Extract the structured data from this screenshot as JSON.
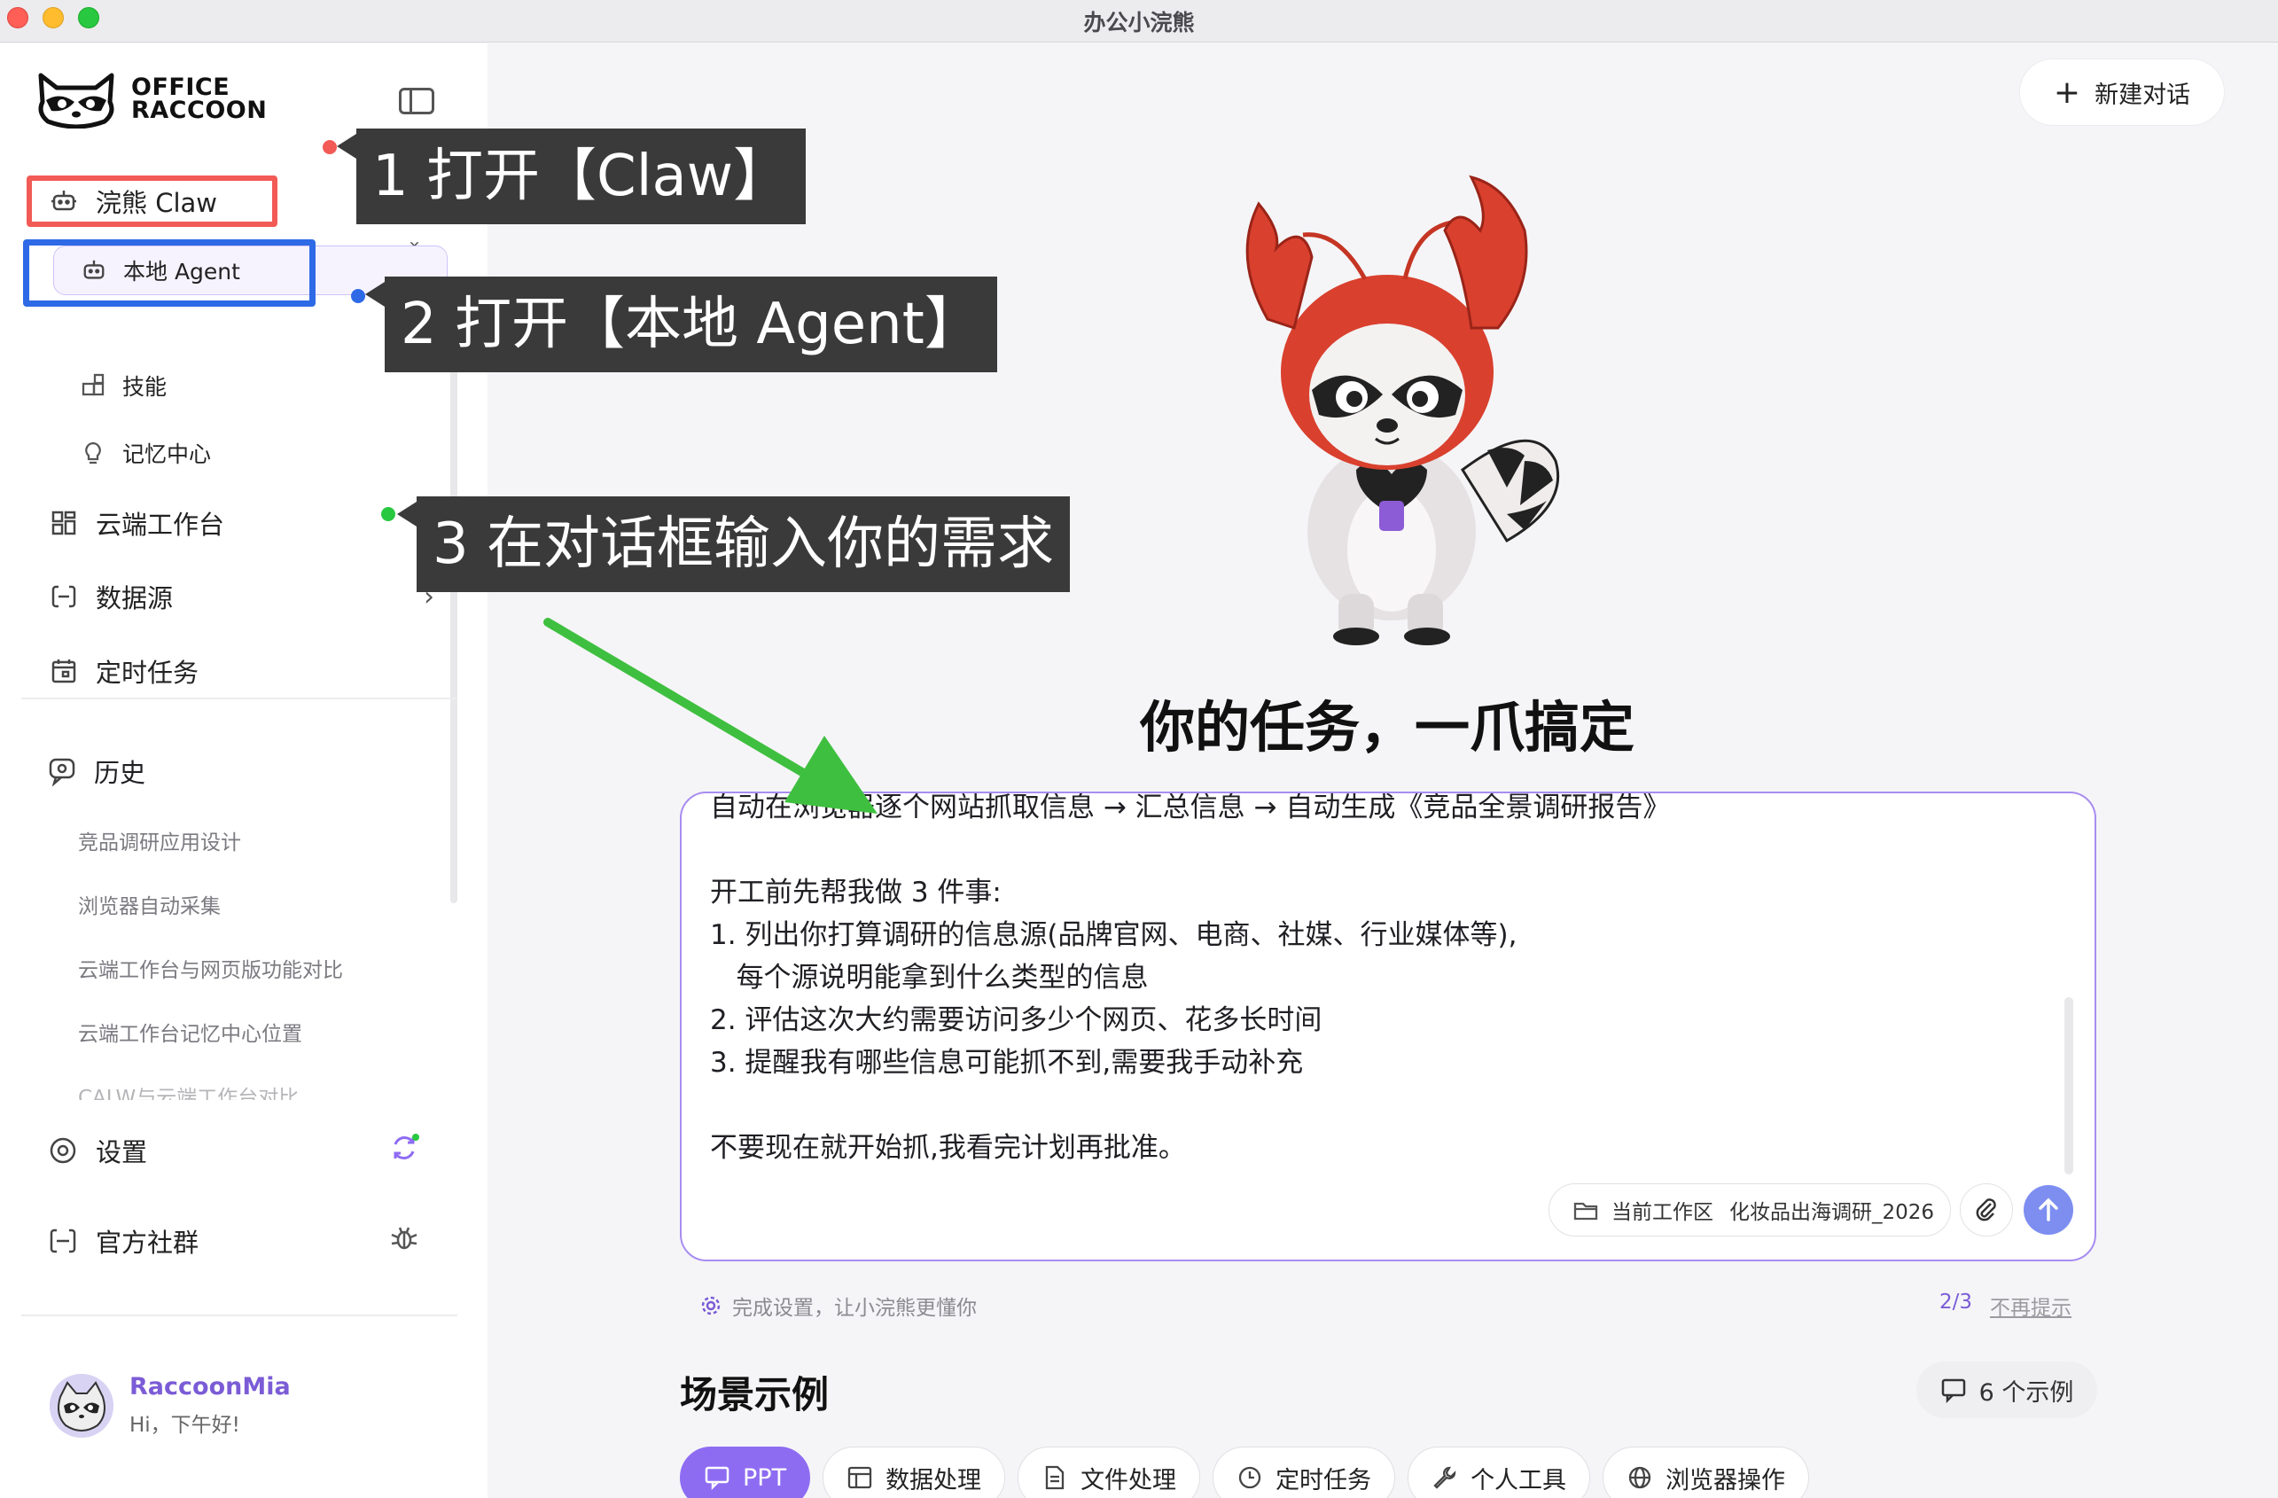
{
  "window": {
    "title": "办公小浣熊"
  },
  "logo": {
    "line1": "OFFICE",
    "line2": "RACCOON"
  },
  "sidebar": {
    "claw": "浣熊 Claw",
    "local_agent": "本地 Agent",
    "skills": "技能",
    "memory": "记忆中心",
    "cloud": "云端工作台",
    "datasource": "数据源",
    "schedule": "定时任务",
    "history_title": "历史",
    "history": [
      "竞品调研应用设计",
      "浏览器自动采集",
      "云端工作台与网页版功能对比",
      "云端工作台记忆中心位置",
      "CALW与云端工作台对比"
    ],
    "settings": "设置",
    "community": "官方社群"
  },
  "user": {
    "name": "RaccoonMia",
    "greeting": "Hi，下午好!"
  },
  "annotations": {
    "step1": "1 打开【Claw】",
    "step2": "2 打开【本地 Agent】",
    "step3": "3 在对话框输入你的需求"
  },
  "main": {
    "new_chat": "新建对话",
    "headline": "你的任务，一爪搞定",
    "input_lines": [
      "自动在浏览器逐个网站抓取信息 → 汇总信息 → 自动生成《竞品全景调研报告》",
      "",
      "开工前先帮我做 3 件事:",
      "1. 列出你打算调研的信息源(品牌官网、电商、社媒、行业媒体等),",
      "   每个源说明能拿到什么类型的信息",
      "2. 评估这次大约需要访问多少个网页、花多长时间",
      "3. 提醒我有哪些信息可能抓不到,需要我手动补充",
      "",
      "不要现在就开始抓,我看完计划再批准。"
    ],
    "workspace_label": "当前工作区",
    "workspace_name": "化妆品出海调研_2026",
    "tip": "完成设置，让小浣熊更懂你",
    "tip_progress": "2/3",
    "tip_dismiss": "不再提示",
    "scene_title": "场景示例",
    "scene_count": "6 个示例",
    "chips": [
      "PPT",
      "数据处理",
      "文件处理",
      "定时任务",
      "个人工具",
      "浏览器操作"
    ]
  },
  "colors": {
    "accent": "#8e6cf2",
    "highlight_red": "#f25a55",
    "highlight_blue": "#2e6ae6",
    "arrow": "#3fbf3f"
  }
}
